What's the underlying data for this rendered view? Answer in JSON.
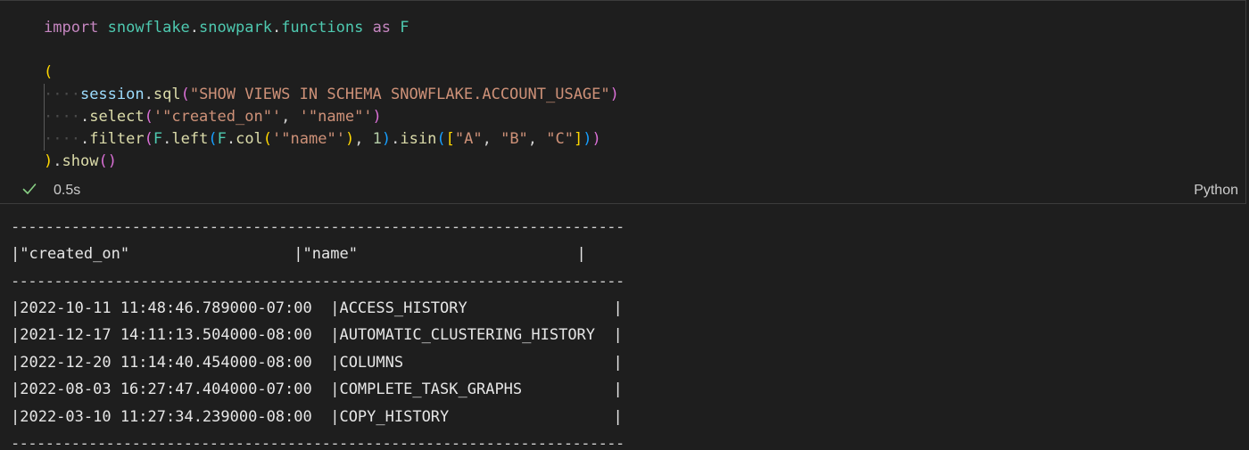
{
  "cell": {
    "code_lines": [
      [
        {
          "t": "import",
          "c": "kw"
        },
        {
          "t": " ",
          "c": "plain"
        },
        {
          "t": "snowflake",
          "c": "mod"
        },
        {
          "t": ".",
          "c": "plain"
        },
        {
          "t": "snowpark",
          "c": "mod"
        },
        {
          "t": ".",
          "c": "plain"
        },
        {
          "t": "functions",
          "c": "mod"
        },
        {
          "t": " ",
          "c": "plain"
        },
        {
          "t": "as",
          "c": "kw"
        },
        {
          "t": " ",
          "c": "plain"
        },
        {
          "t": "F",
          "c": "mod"
        }
      ],
      [],
      [
        {
          "t": "(",
          "c": "paren1"
        }
      ],
      [
        {
          "t": "····",
          "c": "ws"
        },
        {
          "t": "session",
          "c": "var"
        },
        {
          "t": ".",
          "c": "plain"
        },
        {
          "t": "sql",
          "c": "fn"
        },
        {
          "t": "(",
          "c": "paren2"
        },
        {
          "t": "\"SHOW VIEWS IN SCHEMA SNOWFLAKE.ACCOUNT_USAGE\"",
          "c": "str"
        },
        {
          "t": ")",
          "c": "paren2"
        }
      ],
      [
        {
          "t": "····",
          "c": "ws"
        },
        {
          "t": ".",
          "c": "plain"
        },
        {
          "t": "select",
          "c": "fn"
        },
        {
          "t": "(",
          "c": "paren2"
        },
        {
          "t": "'\"created_on\"'",
          "c": "str"
        },
        {
          "t": ", ",
          "c": "plain"
        },
        {
          "t": "'\"name\"'",
          "c": "str"
        },
        {
          "t": ")",
          "c": "paren2"
        }
      ],
      [
        {
          "t": "····",
          "c": "ws"
        },
        {
          "t": ".",
          "c": "plain"
        },
        {
          "t": "filter",
          "c": "fn"
        },
        {
          "t": "(",
          "c": "paren2"
        },
        {
          "t": "F",
          "c": "mod"
        },
        {
          "t": ".",
          "c": "plain"
        },
        {
          "t": "left",
          "c": "fn"
        },
        {
          "t": "(",
          "c": "paren3"
        },
        {
          "t": "F",
          "c": "mod"
        },
        {
          "t": ".",
          "c": "plain"
        },
        {
          "t": "col",
          "c": "fn"
        },
        {
          "t": "(",
          "c": "paren1"
        },
        {
          "t": "'\"name\"'",
          "c": "str"
        },
        {
          "t": ")",
          "c": "paren1"
        },
        {
          "t": ", ",
          "c": "plain"
        },
        {
          "t": "1",
          "c": "num"
        },
        {
          "t": ")",
          "c": "paren3"
        },
        {
          "t": ".",
          "c": "plain"
        },
        {
          "t": "isin",
          "c": "fn"
        },
        {
          "t": "(",
          "c": "paren3"
        },
        {
          "t": "[",
          "c": "paren1"
        },
        {
          "t": "\"A\"",
          "c": "str"
        },
        {
          "t": ", ",
          "c": "plain"
        },
        {
          "t": "\"B\"",
          "c": "str"
        },
        {
          "t": ", ",
          "c": "plain"
        },
        {
          "t": "\"C\"",
          "c": "str"
        },
        {
          "t": "]",
          "c": "paren1"
        },
        {
          "t": ")",
          "c": "paren3"
        },
        {
          "t": ")",
          "c": "paren2"
        }
      ],
      [
        {
          "t": ")",
          "c": "paren1"
        },
        {
          "t": ".",
          "c": "plain"
        },
        {
          "t": "show",
          "c": "fn"
        },
        {
          "t": "(",
          "c": "paren2"
        },
        {
          "t": ")",
          "c": "paren2"
        }
      ]
    ],
    "status_duration": "0.5s",
    "status_icon": "check-icon",
    "language": "Python"
  },
  "output": {
    "separator": "-----------------------------------------------------------------------",
    "header": "|\"created_on\"                  |\"name\"                        |",
    "rows": [
      "|2022-10-11 11:48:46.789000-07:00  |ACCESS_HISTORY                |",
      "|2021-12-17 14:11:13.504000-08:00  |AUTOMATIC_CLUSTERING_HISTORY  |",
      "|2022-12-20 11:14:40.454000-08:00  |COLUMNS                       |",
      "|2022-08-03 16:27:47.404000-07:00  |COMPLETE_TASK_GRAPHS          |",
      "|2022-03-10 11:27:34.239000-08:00  |COPY_HISTORY                  |"
    ]
  },
  "colors": {
    "background": "#1e1e1e",
    "check": "#89d185",
    "keyword": "#c586c0",
    "module": "#4ec9b0",
    "function": "#dcdcaa",
    "string": "#ce9178",
    "number": "#b5cea8"
  }
}
